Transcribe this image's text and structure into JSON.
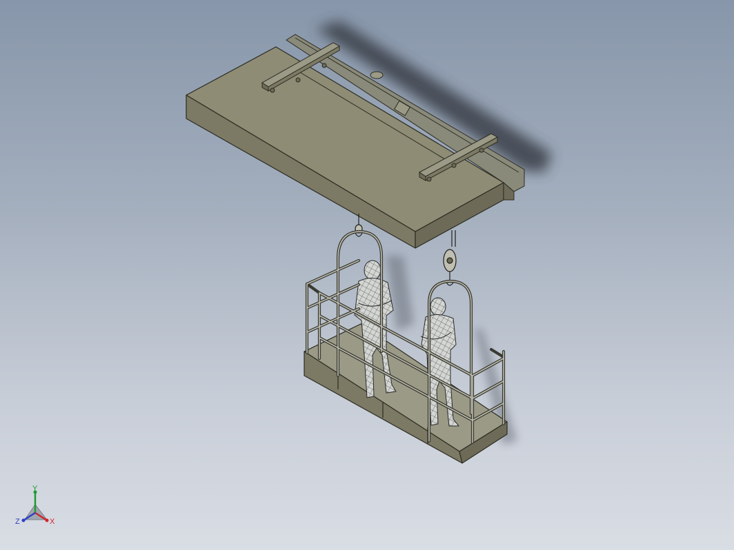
{
  "viewport": {
    "background_top": "#8796aa",
    "background_bottom": "#d9dde4"
  },
  "model": {
    "slab_color": "#8e8c74",
    "edge_color": "#2b2b22",
    "rail_color": "#9a9a86",
    "shadow_color": "#3b414a",
    "figure_color": "#c9cbc8"
  },
  "triad": {
    "x_label": "X",
    "y_label": "Y",
    "z_label": "Z",
    "x_color": "#d0262c",
    "y_color": "#1f9a2e",
    "z_color": "#2a3fc9"
  }
}
